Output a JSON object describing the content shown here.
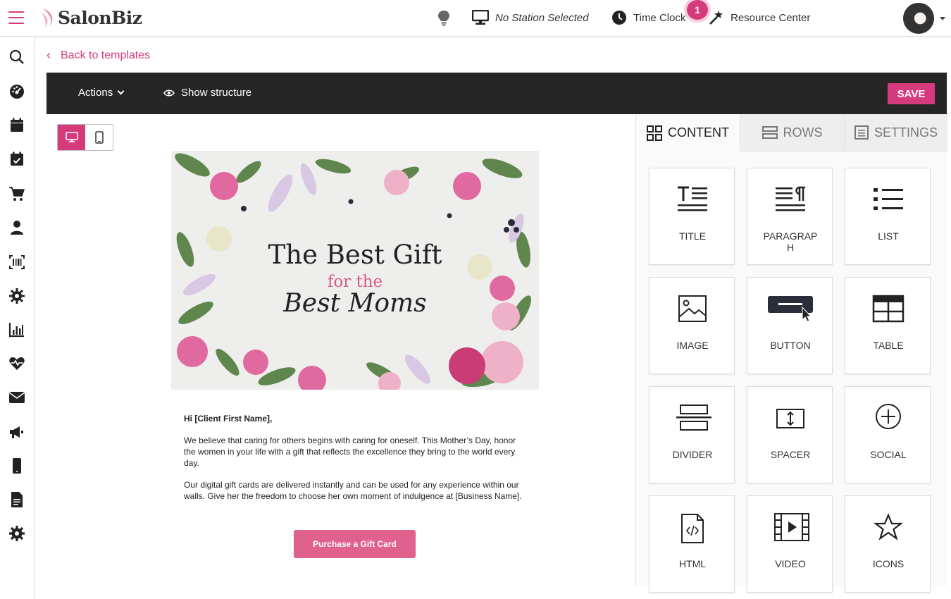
{
  "app": {
    "name": "SalonBiz"
  },
  "header": {
    "station_label": "No Station Selected",
    "timeclock_label": "Time Clock",
    "notification_count": "1",
    "resource_label": "Resource Center"
  },
  "nav": {
    "back_label": "Back to templates"
  },
  "toolbar": {
    "actions_label": "Actions",
    "show_structure_label": "Show structure",
    "save_label": "SAVE"
  },
  "email": {
    "hero_line1": "The Best Gift",
    "hero_line2": "for the",
    "hero_line3": "Best Moms",
    "greeting": "Hi [Client First Name],",
    "paragraph1": "We believe that caring for others begins with caring for oneself. This Mother’s Day, honor the women in your life with a gift that reflects the excellence they bring to the world every day.",
    "paragraph2": "Our digital gift cards are delivered instantly and can be used for any experience within our walls. Give her the freedom to choose her own moment of indulgence at [Business Name].",
    "cta_label": "Purchase a Gift Card"
  },
  "panel": {
    "tabs": [
      "CONTENT",
      "ROWS",
      "SETTINGS"
    ],
    "tiles": [
      "TITLE",
      "PARAGRAPH",
      "LIST",
      "IMAGE",
      "BUTTON",
      "TABLE",
      "DIVIDER",
      "SPACER",
      "SOCIAL",
      "HTML",
      "VIDEO",
      "ICONS"
    ]
  },
  "colors": {
    "accent": "#d63a7c",
    "toolbar": "#262626",
    "cta": "#e0608e"
  }
}
